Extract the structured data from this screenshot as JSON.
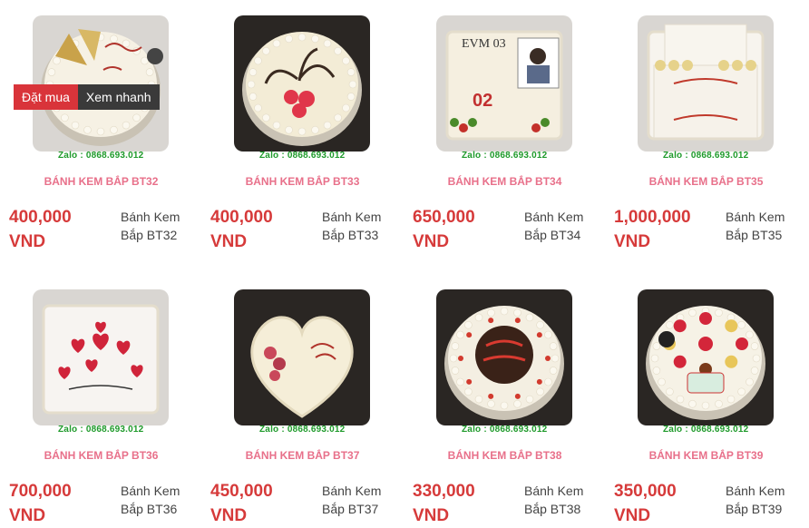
{
  "actions": {
    "order_label": "Đặt mua",
    "quick_view_label": "Xem nhanh"
  },
  "products": [
    {
      "zalo": "Zalo : 0868.693.012",
      "name": "BÁNH KEM BẮP BT32",
      "price": "400,000 VND",
      "category": "Bánh Kem Bắp BT32",
      "cake": "butterfly",
      "icing": "#f6f1e4",
      "shape": "round"
    },
    {
      "zalo": "Zalo : 0868.693.012",
      "name": "BÁNH KEM BẮP BT33",
      "price": "400,000 VND",
      "category": "Bánh Kem Bắp BT33",
      "cake": "roses",
      "icing": "#f3ecd6",
      "shape": "round"
    },
    {
      "zalo": "Zalo : 0868.693.012",
      "name": "BÁNH KEM BẮP BT34",
      "price": "650,000 VND",
      "category": "Bánh Kem Bắp BT34",
      "cake": "photo",
      "icing": "#f5efe0",
      "shape": "square"
    },
    {
      "zalo": "Zalo : 0868.693.012",
      "name": "BÁNH KEM BẮP BT35",
      "price": "1,000,000 VND",
      "category": "Bánh Kem Bắp BT35",
      "cake": "tiered",
      "icing": "#f7f4ee",
      "shape": "square"
    },
    {
      "zalo": "Zalo : 0868.693.012",
      "name": "BÁNH KEM BẮP BT36",
      "price": "700,000 VND",
      "category": "Bánh Kem Bắp BT36",
      "cake": "hearts",
      "icing": "#f7f4f1",
      "shape": "square"
    },
    {
      "zalo": "Zalo : 0868.693.012",
      "name": "BÁNH KEM BẮP BT37",
      "price": "450,000 VND",
      "category": "Bánh Kem Bắp BT37",
      "cake": "heart",
      "icing": "#f5eed8",
      "shape": "heart"
    },
    {
      "zalo": "Zalo : 0868.693.012",
      "name": "BÁNH KEM BẮP BT38",
      "price": "330,000 VND",
      "category": "Bánh Kem Bắp BT38",
      "cake": "plaque",
      "icing": "#f4efe2",
      "shape": "round"
    },
    {
      "zalo": "Zalo : 0868.693.012",
      "name": "BÁNH KEM BẮP BT39",
      "price": "350,000 VND",
      "category": "Bánh Kem Bắp BT39",
      "cake": "fruit",
      "icing": "#f6f2e6",
      "shape": "round"
    }
  ]
}
